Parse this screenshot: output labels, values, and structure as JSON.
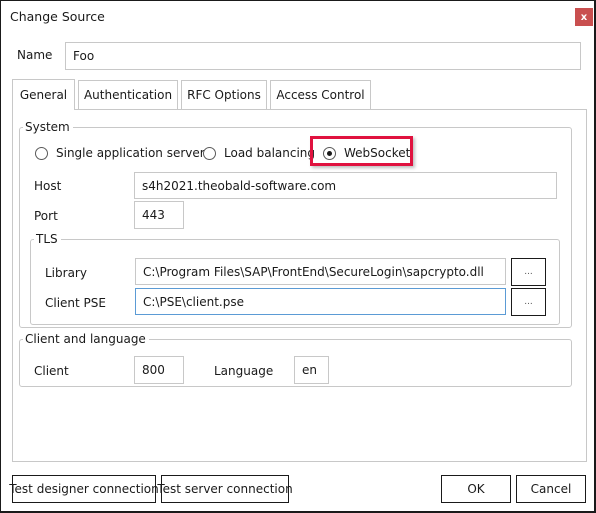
{
  "window": {
    "title": "Change Source",
    "close_label": "x",
    "colors": {
      "close": "#c94f4f",
      "highlight": "#e0123f",
      "focus": "#5b9bd5"
    }
  },
  "name_field": {
    "label": "Name",
    "value": "Foo"
  },
  "tabs": [
    {
      "label": "General",
      "active": true
    },
    {
      "label": "Authentication",
      "active": false
    },
    {
      "label": "RFC Options",
      "active": false
    },
    {
      "label": "Access Control",
      "active": false
    }
  ],
  "system": {
    "legend": "System",
    "connection_types": [
      {
        "label": "Single application server",
        "checked": false
      },
      {
        "label": "Load balancing",
        "checked": false
      },
      {
        "label": "WebSocket",
        "checked": true
      }
    ],
    "host": {
      "label": "Host",
      "value": "s4h2021.theobald-software.com"
    },
    "port": {
      "label": "Port",
      "value": "443"
    },
    "tls": {
      "legend": "TLS",
      "library": {
        "label": "Library",
        "value": "C:\\Program Files\\SAP\\FrontEnd\\SecureLogin\\sapcrypto.dll",
        "browse_label": "..."
      },
      "client_pse": {
        "label": "Client PSE",
        "value": "C:\\PSE\\client.pse",
        "browse_label": "..."
      }
    }
  },
  "client_language": {
    "legend": "Client and language",
    "client": {
      "label": "Client",
      "value": "800"
    },
    "language": {
      "label": "Language",
      "value": "en"
    }
  },
  "footer": {
    "test_designer": "Test designer connection",
    "test_server": "Test server connection",
    "ok": "OK",
    "cancel": "Cancel"
  }
}
